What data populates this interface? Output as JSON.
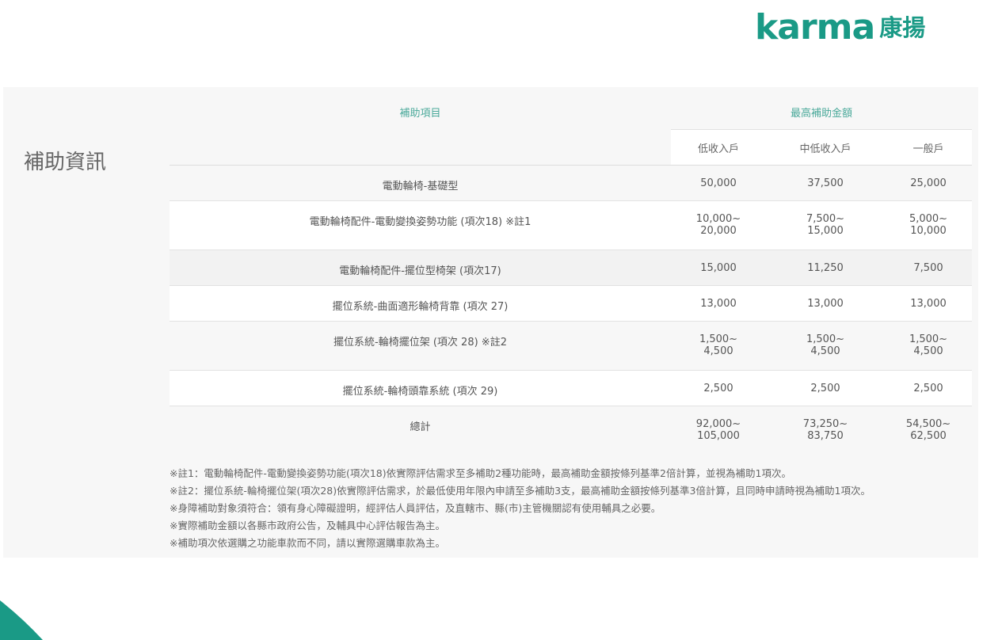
{
  "brand": {
    "name_en": "karma",
    "name_zh": "康揚",
    "color": "#1a9a86"
  },
  "section_title": "補助資訊",
  "table": {
    "header_item": "補助項目",
    "header_amount": "最高補助金額",
    "columns": [
      "低收入戶",
      "中低收入戶",
      "一般戶"
    ],
    "rows": [
      {
        "item": "電動輪椅-基礎型",
        "low": [
          "50,000"
        ],
        "midlow": [
          "37,500"
        ],
        "general": [
          "25,000"
        ]
      },
      {
        "item": "電動輪椅配件-電動變換姿勢功能 (項次18) ※註1",
        "low": [
          "10,000~",
          "20,000"
        ],
        "midlow": [
          "7,500~",
          "15,000"
        ],
        "general": [
          "5,000~",
          "10,000"
        ]
      },
      {
        "item": "電動輪椅配件-擺位型椅架 (項次17)",
        "low": [
          "15,000"
        ],
        "midlow": [
          "11,250"
        ],
        "general": [
          "7,500"
        ]
      },
      {
        "item": "擺位系統-曲面適形輪椅背靠 (項次 27)",
        "low": [
          "13,000"
        ],
        "midlow": [
          "13,000"
        ],
        "general": [
          "13,000"
        ]
      },
      {
        "item": "擺位系統-輪椅擺位架 (項次 28) ※註2",
        "low": [
          "1,500~",
          "4,500"
        ],
        "midlow": [
          "1,500~",
          "4,500"
        ],
        "general": [
          "1,500~",
          "4,500"
        ]
      },
      {
        "item": "擺位系統-輪椅頭靠系統 (項次 29)",
        "low": [
          "2,500"
        ],
        "midlow": [
          "2,500"
        ],
        "general": [
          "2,500"
        ]
      }
    ],
    "total": {
      "item": "總計",
      "low": [
        "92,000~",
        "105,000"
      ],
      "midlow": [
        "73,250~",
        "83,750"
      ],
      "general": [
        "54,500~",
        "62,500"
      ]
    }
  },
  "notes": [
    "※註1：電動輪椅配件-電動變換姿勢功能(項次18)依實際評估需求至多補助2種功能時，最高補助金額按條列基準2倍計算，並視為補助1項次。",
    "※註2：擺位系統-輪椅擺位架(項次28)依實際評估需求，於最低使用年限內申請至多補助3支，最高補助金額按條列基準3倍計算，且同時申請時視為補助1項次。",
    "※身障補助對象須符合：領有身心障礙證明，經評估人員評估，及直轄市、縣(市)主管機關認有使用輔具之必要。",
    "※實際補助金額以各縣市政府公告，及輔具中心評估報告為主。",
    "※補助項次依選購之功能車款而不同，請以實際選購車款為主。"
  ]
}
